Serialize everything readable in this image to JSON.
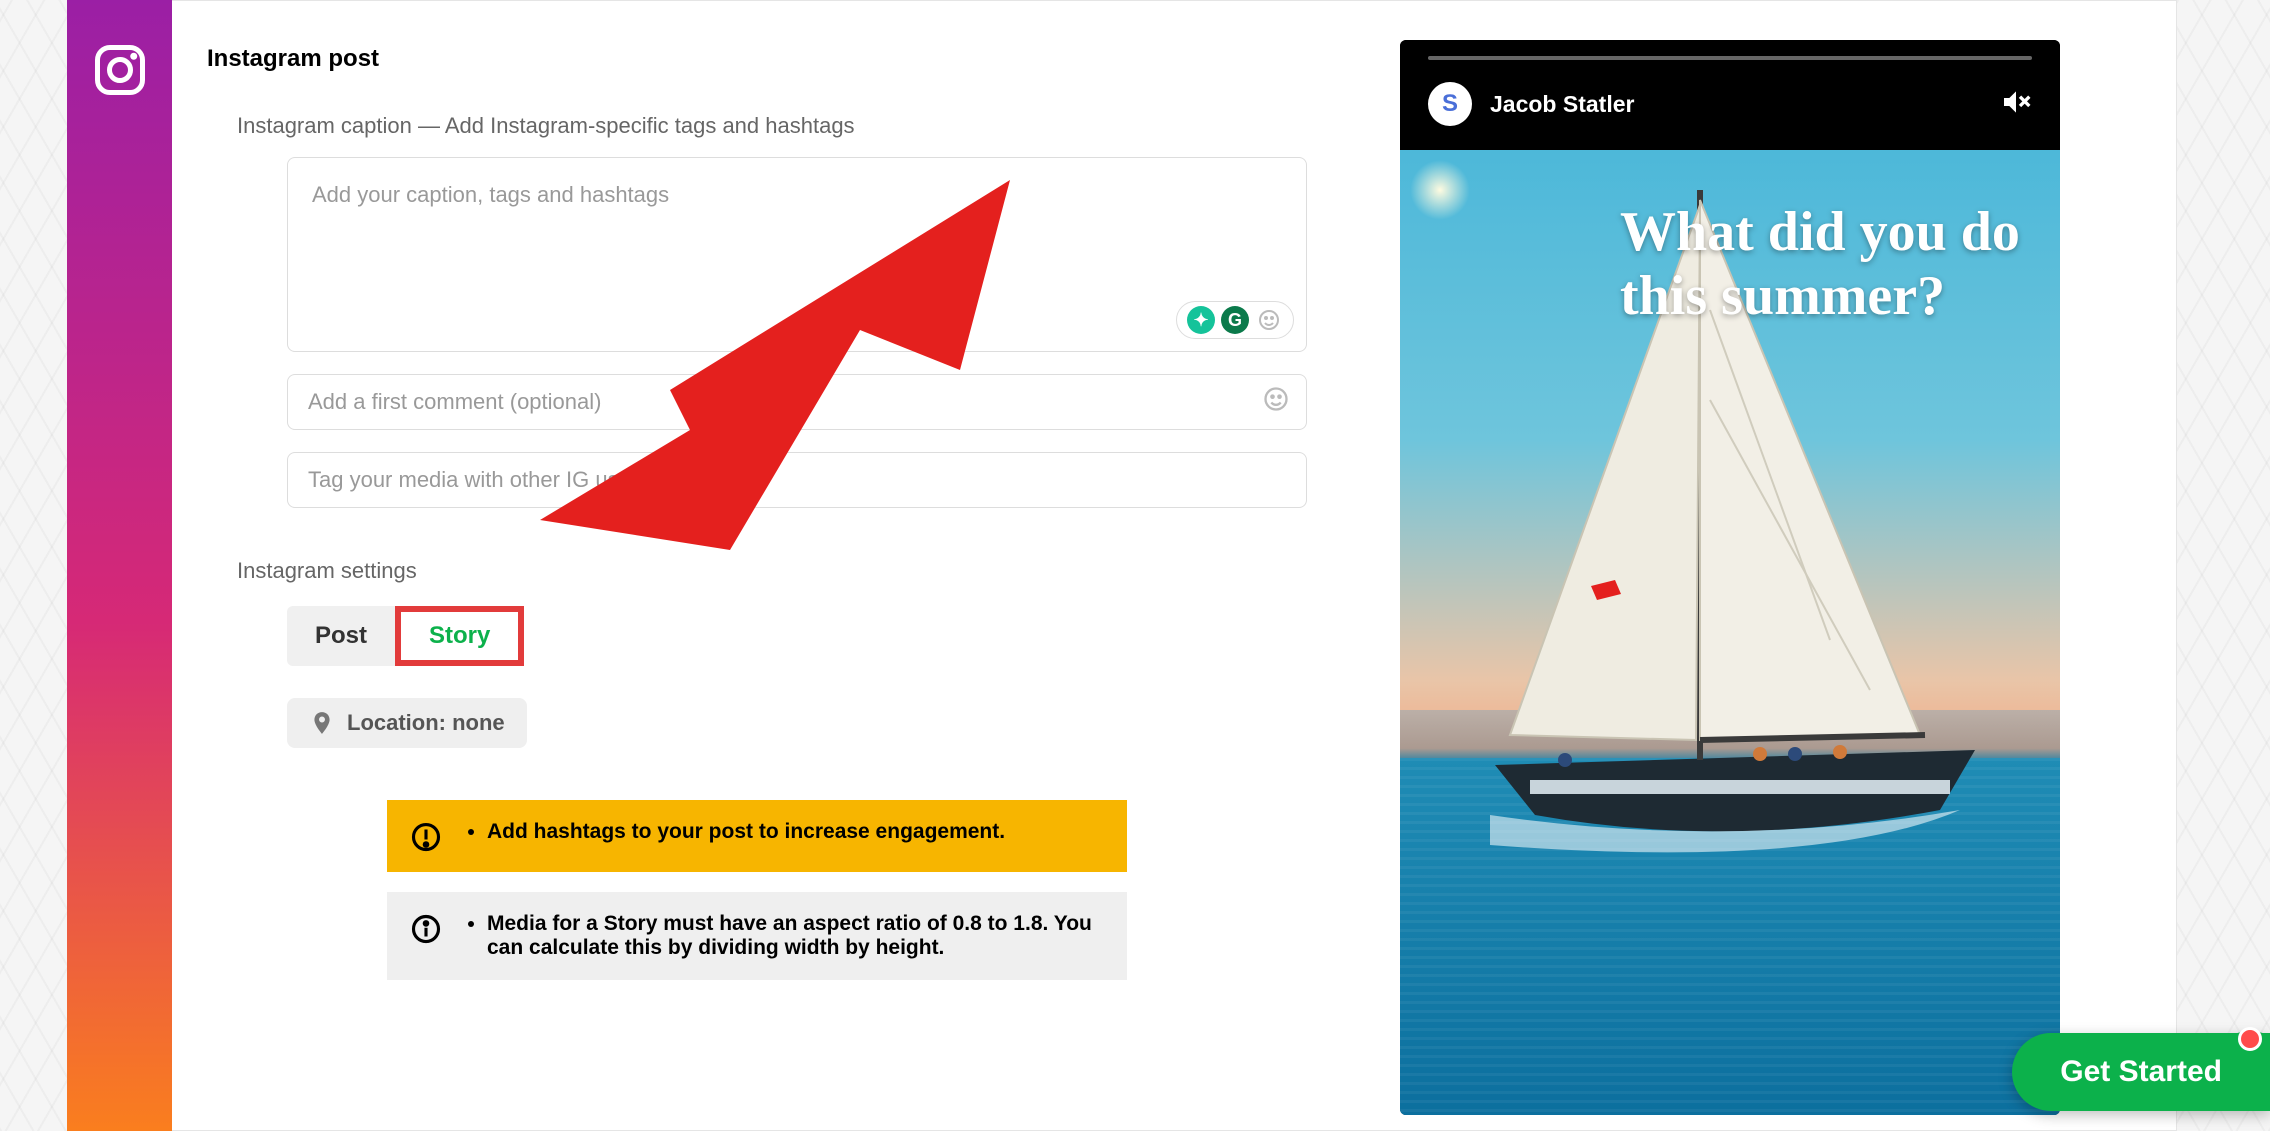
{
  "section": {
    "title": "Instagram post"
  },
  "caption": {
    "label": "Instagram caption — Add Instagram-specific tags and hashtags",
    "placeholder": "Add your caption, tags and hashtags"
  },
  "first_comment": {
    "placeholder": "Add a first comment (optional)"
  },
  "tag_users": {
    "placeholder": "Tag your media with other IG users ("
  },
  "settings": {
    "label": "Instagram settings",
    "tabs": {
      "post": "Post",
      "story": "Story"
    },
    "location": "Location: none"
  },
  "alerts": {
    "hashtags": "Add hashtags to your post to increase engagement.",
    "ratio": "Media for a Story must have an aspect ratio of 0.8 to 1.8. You can calculate this by dividing width by height."
  },
  "preview": {
    "username": "Jacob Statler",
    "avatar_letter": "S",
    "overlay_text": "What did you do this summer?"
  },
  "cta": {
    "get_started": "Get Started"
  },
  "colors": {
    "accent_green": "#0cb14b",
    "warn_yellow": "#f7b500",
    "highlight_red": "#e23b3b"
  }
}
